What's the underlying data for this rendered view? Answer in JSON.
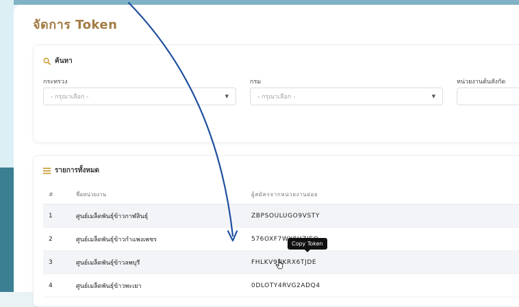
{
  "page": {
    "title": "จัดการ Token"
  },
  "search": {
    "header": "ค้นหา",
    "icon": "search-icon",
    "fields": [
      {
        "label": "กระทรวง",
        "value": "- กรุณาเลือก -"
      },
      {
        "label": "กรม",
        "value": "- กรุณาเลือก -"
      },
      {
        "label": "หน่วยงานต้นสังกัด",
        "value": ""
      }
    ]
  },
  "list": {
    "header": "รายการทั้งหมด",
    "icon": "list-icon",
    "columns": [
      "#",
      "ชื่อหน่วยงาน",
      "ผู้สมัครจากหน่วยงานย่อย"
    ],
    "rows": [
      {
        "num": "1",
        "name": "ศูนย์เมล็ดพันธุ์ข้าวกาฬสินธุ์",
        "token": "ZBPSOULUGO9VSTY"
      },
      {
        "num": "2",
        "name": "ศูนย์เมล็ดพันธุ์ข้าวกำแพงเพชร",
        "token": "576OXF7WY8HZJEQ"
      },
      {
        "num": "3",
        "name": "ศูนย์เมล็ดพันธุ์ข้าวลพบุรี",
        "token": "FHLKV9UKRX6TJDE"
      },
      {
        "num": "4",
        "name": "ศูนย์เมล็ดพันธุ์ข้าวพะเยา",
        "token": "0DLOTY4RVG2ADQ4"
      }
    ]
  },
  "tooltip": {
    "text": "Copy Token"
  },
  "colors": {
    "title": "#a37b43",
    "annotation_arrow": "#1d4e9e",
    "section_icon": "#c9972e"
  }
}
